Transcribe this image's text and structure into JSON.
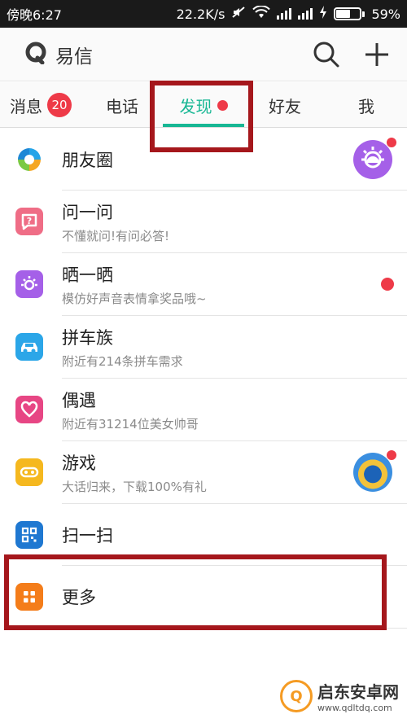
{
  "status_bar": {
    "time": "傍晚6:27",
    "network_speed": "22.2K/s",
    "battery": "59%",
    "battery_level": 0.59,
    "icons": [
      "mute-icon",
      "wifi-icon",
      "signal-icon",
      "signal-icon",
      "charging-icon",
      "battery-icon"
    ]
  },
  "app_bar": {
    "title": "易信",
    "actions": [
      "search-icon",
      "plus-icon"
    ]
  },
  "tabs": [
    {
      "label": "消息",
      "badge": "20"
    },
    {
      "label": "电话"
    },
    {
      "label": "发现",
      "active": true,
      "dot": true
    },
    {
      "label": "好友"
    },
    {
      "label": "我"
    }
  ],
  "discover": [
    {
      "title": "朋友圈",
      "icon": "moments-icon",
      "color": "#1e9ee6"
    },
    {
      "title": "问一问",
      "subtitle": "不懂就问!有问必答!",
      "icon": "question-icon",
      "color": "#ef6d86"
    },
    {
      "title": "晒一晒",
      "subtitle": "模仿好声音表情拿奖品哦~",
      "icon": "sun-icon",
      "color": "#a560e8"
    },
    {
      "title": "拼车族",
      "subtitle": "附近有214条拼车需求",
      "icon": "car-icon",
      "color": "#2ba6e8"
    },
    {
      "title": "偶遇",
      "subtitle": "附近有31214位美女帅哥",
      "icon": "heart-icon",
      "color": "#e74684"
    },
    {
      "title": "游戏",
      "subtitle": "大话归来，下载100%有礼",
      "icon": "game-icon",
      "color": "#f5b81f"
    },
    {
      "title": "扫一扫",
      "icon": "qr-scan-icon",
      "color": "#1f78d1"
    },
    {
      "title": "更多",
      "icon": "more-grid-icon",
      "color": "#f47d1a"
    }
  ],
  "watermark": {
    "title": "启东安卓网",
    "url": "www.qdltdq.com",
    "logo_text": "Q"
  },
  "colors": {
    "accent": "#17b794",
    "badge": "#ee3a48",
    "highlight": "#a5171c"
  }
}
